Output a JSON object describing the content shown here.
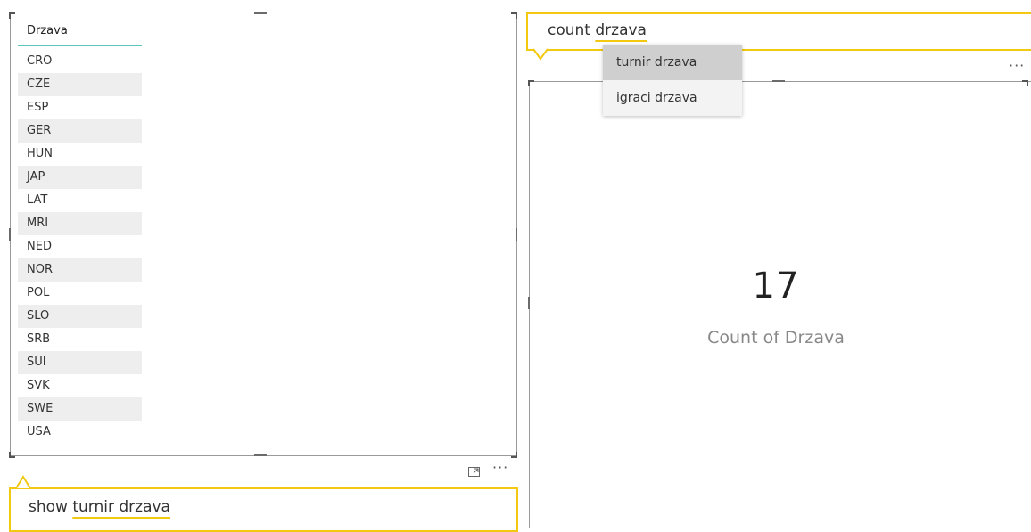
{
  "table": {
    "header": "Drzava",
    "rows": [
      "CRO",
      "CZE",
      "ESP",
      "GER",
      "HUN",
      "JAP",
      "LAT",
      "MRI",
      "NED",
      "NOR",
      "POL",
      "SLO",
      "SRB",
      "SUI",
      "SVK",
      "SWE",
      "USA"
    ]
  },
  "qna_left": {
    "prefix": "show ",
    "highlight": "turnir drzava"
  },
  "qna_right": {
    "prefix": "count ",
    "highlight": "drzava"
  },
  "suggestions": [
    "turnir drzava",
    "igraci drzava"
  ],
  "card": {
    "value": "17",
    "label": "Count of Drzava"
  },
  "more_options_glyph": "···",
  "focus_icon": "focus-mode-icon",
  "accent_color": "#f2c811",
  "header_underline_color": "#5ec8c0"
}
